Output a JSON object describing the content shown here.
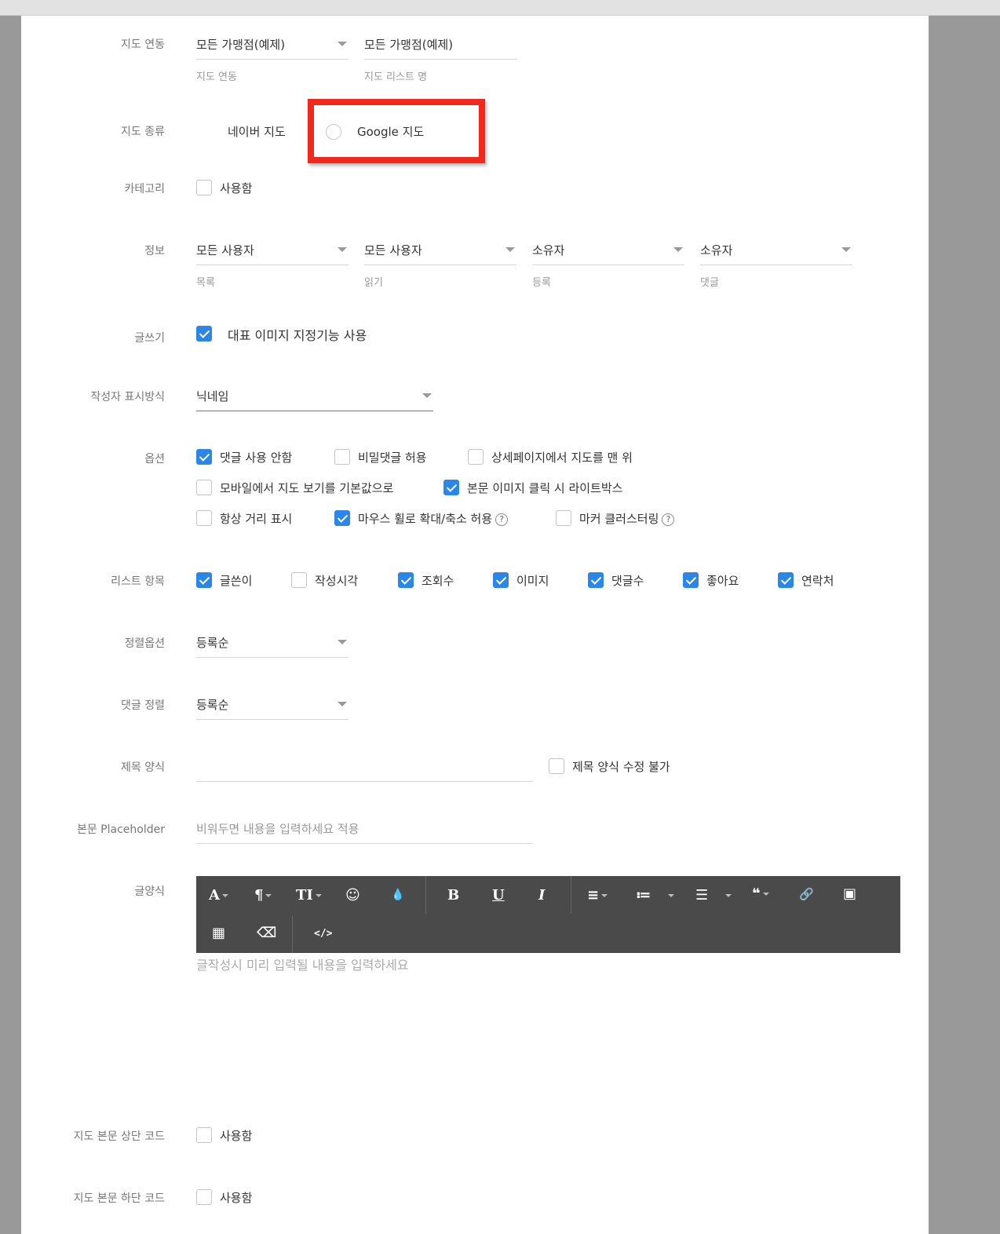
{
  "labels": {
    "map_link": "지도 연동",
    "map_type": "지도 종류",
    "category": "카테고리",
    "info": "정보",
    "write": "글쓰기",
    "author_display": "작성자 표시방식",
    "options": "옵션",
    "list_items": "리스트 항목",
    "sort_option": "정렬옵션",
    "comment_sort": "댓글 정렬",
    "title_format": "제목 양식",
    "body_placeholder": "본문 Placeholder",
    "post_format": "글양식",
    "top_code": "지도 본문 상단 코드",
    "bottom_code": "지도 본문 하단 코드"
  },
  "map_link": {
    "select_value": "모든 가맹점(예제)",
    "select_sub": "지도 연동",
    "list_name_value": "모든 가맹점(예제)",
    "list_name_sub": "지도 리스트 명"
  },
  "map_type": {
    "naver": "네이버 지도",
    "google": "Google 지도"
  },
  "category": {
    "use_label": "사용함"
  },
  "info": [
    {
      "value": "모든 사용자",
      "sub": "목록"
    },
    {
      "value": "모든 사용자",
      "sub": "읽기"
    },
    {
      "value": "소유자",
      "sub": "등록"
    },
    {
      "value": "소유자",
      "sub": "댓글"
    }
  ],
  "write": {
    "rep_image": "대표 이미지 지정기능 사용"
  },
  "author_display": {
    "value": "닉네임"
  },
  "options": {
    "no_comments": "댓글 사용 안함",
    "secret_comments": "비밀댓글 허용",
    "map_top_detail": "상세페이지에서 지도를 맨 위",
    "mobile_map_default": "모바일에서 지도 보기를 기본값으로",
    "lightbox": "본문 이미지 클릭 시 라이트박스",
    "distance": "항상 거리 표시",
    "wheel_zoom": "마우스 휠로 확대/축소 허용",
    "clustering": "마커 클러스터링",
    "help": "?"
  },
  "list_items": [
    "글쓴이",
    "작성시각",
    "조회수",
    "이미지",
    "댓글수",
    "좋아요",
    "연락처"
  ],
  "sort_option": {
    "value": "등록순"
  },
  "comment_sort": {
    "value": "등록순"
  },
  "title_format": {
    "lock_label": "제목 양식 수정 불가"
  },
  "body_placeholder": {
    "placeholder": "비워두면 내용을 입력하세요 적용"
  },
  "editor": {
    "placeholder": "글작성시 미리 입력될 내용을 입력하세요",
    "tools": {
      "font": "A",
      "paragraph": "¶",
      "text_size": "TI",
      "emoji": "☺",
      "color": "💧",
      "bold": "B",
      "underline": "U",
      "italic": "I",
      "align": "≡",
      "ordered": "≔",
      "unordered": "☰",
      "quote": "❝",
      "link": "🔗",
      "image": "▣",
      "table": "▦",
      "eraser": "⌫",
      "code": "</>"
    }
  },
  "top_code": {
    "use_label": "사용함"
  },
  "bottom_code": {
    "use_label": "사용함"
  }
}
